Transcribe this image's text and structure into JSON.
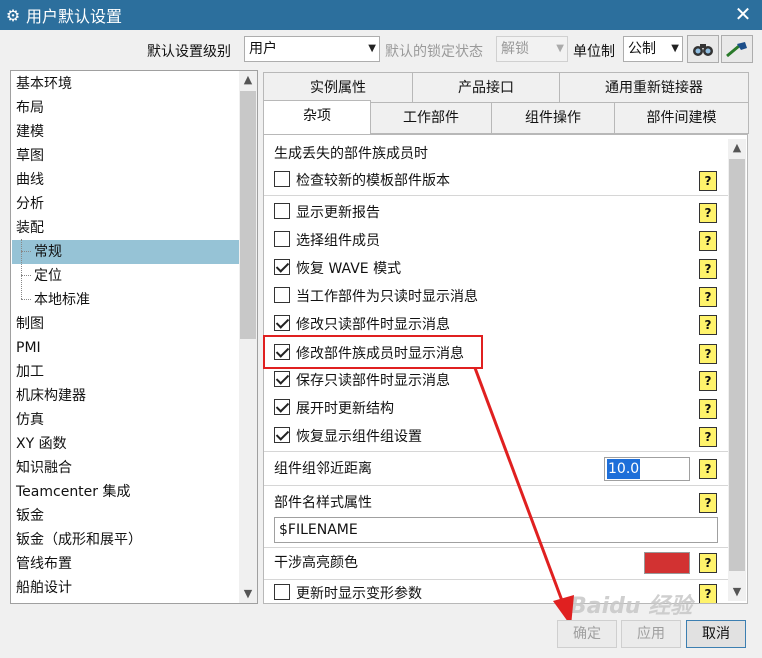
{
  "window": {
    "title": "用户默认设置",
    "close": "✕"
  },
  "toolbar": {
    "level_label": "默认设置级别",
    "level_value": "用户",
    "lock_label": "默认的锁定状态",
    "lock_value": "解锁",
    "unit_label": "单位制",
    "unit_value": "公制"
  },
  "tree": {
    "items": [
      {
        "label": "基本环境"
      },
      {
        "label": "布局"
      },
      {
        "label": "建模"
      },
      {
        "label": "草图"
      },
      {
        "label": "曲线"
      },
      {
        "label": "分析"
      },
      {
        "label": "装配"
      },
      {
        "label": "常规",
        "selected": true,
        "child": true
      },
      {
        "label": "定位",
        "child": true
      },
      {
        "label": "本地标准",
        "child": true
      },
      {
        "label": "制图"
      },
      {
        "label": "PMI"
      },
      {
        "label": "加工"
      },
      {
        "label": "机床构建器"
      },
      {
        "label": "仿真"
      },
      {
        "label": "XY 函数"
      },
      {
        "label": "知识融合"
      },
      {
        "label": "Teamcenter 集成"
      },
      {
        "label": "钣金"
      },
      {
        "label": "钣金（成形和展平）"
      },
      {
        "label": "管线布置"
      },
      {
        "label": "船舶设计"
      }
    ]
  },
  "tabs": {
    "row1": [
      "实例属性",
      "产品接口",
      "通用重新链接器"
    ],
    "row2": [
      "杂项",
      "工作部件",
      "组件操作",
      "部件间建模"
    ],
    "active": "杂项"
  },
  "panel": {
    "section_title": "生成丢失的部件族成员时",
    "opt_check_template": {
      "label": "检查较新的模板部件版本",
      "checked": false
    },
    "opt_update_report": {
      "label": "显示更新报告",
      "checked": false
    },
    "opt_select_members": {
      "label": "选择组件成员",
      "checked": false
    },
    "opt_restore_wave": {
      "label": "恢复 WAVE 模式",
      "checked": true
    },
    "opt_readonly_work": {
      "label": "当工作部件为只读时显示消息",
      "checked": false
    },
    "opt_modify_readonly": {
      "label": "修改只读部件时显示消息",
      "checked": true
    },
    "opt_modify_family": {
      "label": "修改部件族成员时显示消息",
      "checked": true
    },
    "opt_save_readonly": {
      "label": "保存只读部件时显示消息",
      "checked": true
    },
    "opt_update_expand": {
      "label": "展开时更新结构",
      "checked": true
    },
    "opt_restore_groups": {
      "label": "恢复显示组件组设置",
      "checked": true
    },
    "proximity_label": "组件组邻近距离",
    "proximity_value": "10.0",
    "name_attr_label": "部件名样式属性",
    "name_attr_value": "$FILENAME",
    "interference_label": "干涉高亮颜色",
    "interference_color": "#d23232",
    "opt_show_deform": {
      "label": "更新时显示变形参数",
      "checked": false
    },
    "help_glyph": "?"
  },
  "buttons": {
    "ok": "确定",
    "apply": "应用",
    "cancel": "取消"
  },
  "watermark": "Baidu 经验",
  "colors": {
    "titlebar": "#2c6f9d",
    "selected": "#96c3d6",
    "highlight": "#e02020",
    "help": "#fff36b"
  }
}
